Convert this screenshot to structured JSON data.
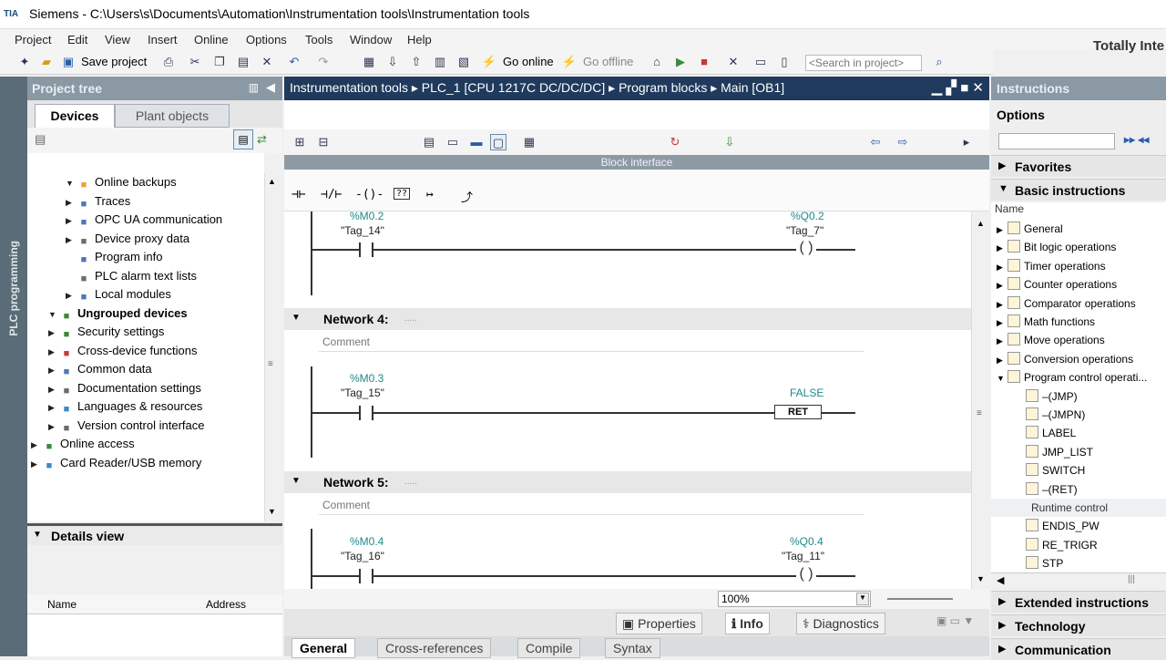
{
  "window": {
    "logo_text": "TIA",
    "title": "Siemens  -  C:\\Users\\s\\Documents\\Automation\\Instrumentation tools\\Instrumentation tools",
    "brand": "Totally Inte"
  },
  "menu": [
    "Project",
    "Edit",
    "View",
    "Insert",
    "Online",
    "Options",
    "Tools",
    "Window",
    "Help"
  ],
  "toolbar": {
    "save_label": "Save project",
    "go_online": "Go online",
    "go_offline": "Go offline",
    "search_placeholder": "<Search in project>"
  },
  "project_tree": {
    "vertical_label": "PLC programming",
    "header": "Project tree",
    "tabs": [
      "Devices",
      "Plant objects"
    ],
    "items": [
      {
        "label": "Online backups",
        "indent": 3,
        "arrow": "down",
        "icon": "folder-icon",
        "color": "#e5a43a"
      },
      {
        "label": "Traces",
        "indent": 3,
        "arrow": "right",
        "icon": "trace-icon",
        "color": "#4a78b6"
      },
      {
        "label": "OPC UA communication",
        "indent": 3,
        "arrow": "right",
        "icon": "opcua-icon",
        "color": "#4a78b6"
      },
      {
        "label": "Device proxy data",
        "indent": 3,
        "arrow": "right",
        "icon": "proxy-icon",
        "color": "#6b6b6b"
      },
      {
        "label": "Program info",
        "indent": 3,
        "arrow": "",
        "icon": "info-icon",
        "color": "#4a78b6"
      },
      {
        "label": "PLC alarm text lists",
        "indent": 3,
        "arrow": "",
        "icon": "list-icon",
        "color": "#6b6b6b"
      },
      {
        "label": "Local modules",
        "indent": 3,
        "arrow": "right",
        "icon": "module-icon",
        "color": "#4a78b6"
      },
      {
        "label": "Ungrouped devices",
        "indent": 2,
        "arrow": "down",
        "icon": "devices-icon",
        "color": "#3a8a3a",
        "bold": true
      },
      {
        "label": "Security settings",
        "indent": 2,
        "arrow": "right",
        "icon": "security-icon",
        "color": "#3a8a3a"
      },
      {
        "label": "Cross-device functions",
        "indent": 2,
        "arrow": "right",
        "icon": "cross-icon",
        "color": "#c83a3a"
      },
      {
        "label": "Common data",
        "indent": 2,
        "arrow": "right",
        "icon": "common-icon",
        "color": "#4a78b6"
      },
      {
        "label": "Documentation settings",
        "indent": 2,
        "arrow": "right",
        "icon": "doc-icon",
        "color": "#6b6b6b"
      },
      {
        "label": "Languages & resources",
        "indent": 2,
        "arrow": "right",
        "icon": "globe-icon",
        "color": "#3a8ac8"
      },
      {
        "label": "Version control interface",
        "indent": 2,
        "arrow": "right",
        "icon": "version-icon",
        "color": "#6b6b6b"
      },
      {
        "label": "Online access",
        "indent": 1,
        "arrow": "right",
        "icon": "online-icon",
        "color": "#3a8a3a"
      },
      {
        "label": "Card Reader/USB memory",
        "indent": 1,
        "arrow": "right",
        "icon": "card-icon",
        "color": "#3a8ac8"
      }
    ],
    "details_title": "Details view",
    "details_columns": [
      "Name",
      "Address"
    ]
  },
  "editor": {
    "breadcrumb": "Instrumentation tools  ▸  PLC_1 [CPU 1217C DC/DC/DC]  ▸  Program blocks  ▸  Main [OB1]",
    "block_interface": "Block interface",
    "ladder_tools": [
      "⊣⊢",
      "⊣/⊢",
      "-()-",
      "??",
      "↦",
      "⤴"
    ],
    "comment_placeholder": "Comment",
    "networks": [
      {
        "title": "",
        "contact_addr": "%M0.2",
        "contact_tag": "\"Tag_14\"",
        "coil_addr": "%Q0.2",
        "coil_tag": "\"Tag_7\""
      },
      {
        "title": "Network 4:",
        "contact_addr": "%M0.3",
        "contact_tag": "\"Tag_15\"",
        "coil_addr": "FALSE",
        "coil_label": "RET"
      },
      {
        "title": "Network 5:",
        "contact_addr": "%M0.4",
        "contact_tag": "\"Tag_16\"",
        "coil_addr": "%Q0.4",
        "coil_tag": "\"Tag_11\""
      }
    ],
    "zoom": "100%",
    "inspector_tabs": [
      "Properties",
      "Info",
      "Diagnostics"
    ],
    "bottom_tabs": [
      "General",
      "Cross-references",
      "Compile",
      "Syntax"
    ]
  },
  "instructions": {
    "header": "Instructions",
    "options": "Options",
    "favorites": "Favorites",
    "basic": "Basic instructions",
    "column": "Name",
    "items": [
      {
        "label": "General",
        "arrow": "right",
        "icon": "folder-icon"
      },
      {
        "label": "Bit logic operations",
        "arrow": "right",
        "icon": "bit-logic-icon"
      },
      {
        "label": "Timer operations",
        "arrow": "right",
        "icon": "timer-icon"
      },
      {
        "label": "Counter operations",
        "arrow": "right",
        "icon": "counter-icon"
      },
      {
        "label": "Comparator operations",
        "arrow": "right",
        "icon": "comparator-icon"
      },
      {
        "label": "Math functions",
        "arrow": "right",
        "icon": "math-icon"
      },
      {
        "label": "Move operations",
        "arrow": "right",
        "icon": "move-icon"
      },
      {
        "label": "Conversion operations",
        "arrow": "right",
        "icon": "conversion-icon"
      },
      {
        "label": "Program control operati...",
        "arrow": "down",
        "icon": "program-control-icon"
      },
      {
        "label": "–(JMP)",
        "arrow": "",
        "icon": "jmp-icon",
        "indent": 1
      },
      {
        "label": "–(JMPN)",
        "arrow": "",
        "icon": "jmpn-icon",
        "indent": 1
      },
      {
        "label": "LABEL",
        "arrow": "",
        "icon": "label-icon",
        "indent": 1
      },
      {
        "label": "JMP_LIST",
        "arrow": "",
        "icon": "jmplist-icon",
        "indent": 1
      },
      {
        "label": "SWITCH",
        "arrow": "",
        "icon": "switch-icon",
        "indent": 1
      },
      {
        "label": "–(RET)",
        "arrow": "",
        "icon": "ret-icon",
        "indent": 1
      },
      {
        "label": "Runtime control",
        "arrow": "",
        "icon": "",
        "indent": 1,
        "group": true
      },
      {
        "label": "ENDIS_PW",
        "arrow": "",
        "icon": "endis-icon",
        "indent": 1
      },
      {
        "label": "RE_TRIGR",
        "arrow": "",
        "icon": "retrigr-icon",
        "indent": 1
      },
      {
        "label": "STP",
        "arrow": "",
        "icon": "stp-icon",
        "indent": 1
      }
    ],
    "sections_bottom": [
      "Extended instructions",
      "Technology",
      "Communication"
    ]
  }
}
